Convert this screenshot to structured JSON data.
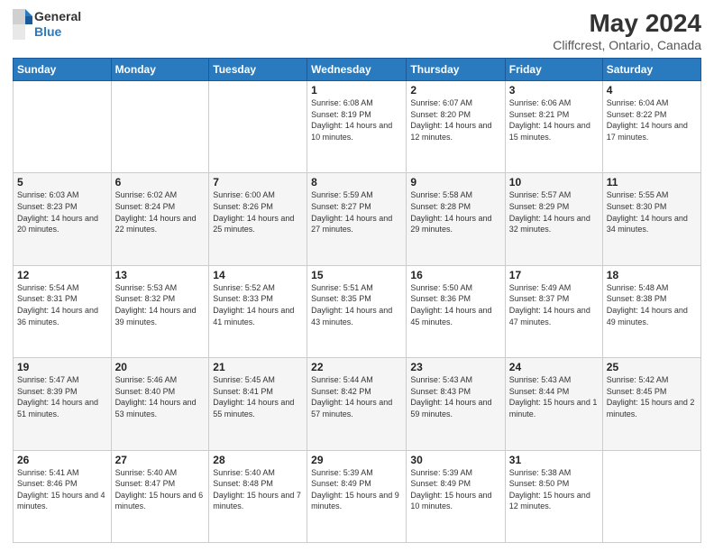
{
  "header": {
    "logo_line1": "General",
    "logo_line2": "Blue",
    "main_title": "May 2024",
    "sub_title": "Cliffcrest, Ontario, Canada"
  },
  "weekdays": [
    "Sunday",
    "Monday",
    "Tuesday",
    "Wednesday",
    "Thursday",
    "Friday",
    "Saturday"
  ],
  "weeks": [
    [
      {
        "day": "",
        "detail": ""
      },
      {
        "day": "",
        "detail": ""
      },
      {
        "day": "",
        "detail": ""
      },
      {
        "day": "1",
        "detail": "Sunrise: 6:08 AM\nSunset: 8:19 PM\nDaylight: 14 hours\nand 10 minutes."
      },
      {
        "day": "2",
        "detail": "Sunrise: 6:07 AM\nSunset: 8:20 PM\nDaylight: 14 hours\nand 12 minutes."
      },
      {
        "day": "3",
        "detail": "Sunrise: 6:06 AM\nSunset: 8:21 PM\nDaylight: 14 hours\nand 15 minutes."
      },
      {
        "day": "4",
        "detail": "Sunrise: 6:04 AM\nSunset: 8:22 PM\nDaylight: 14 hours\nand 17 minutes."
      }
    ],
    [
      {
        "day": "5",
        "detail": "Sunrise: 6:03 AM\nSunset: 8:23 PM\nDaylight: 14 hours\nand 20 minutes."
      },
      {
        "day": "6",
        "detail": "Sunrise: 6:02 AM\nSunset: 8:24 PM\nDaylight: 14 hours\nand 22 minutes."
      },
      {
        "day": "7",
        "detail": "Sunrise: 6:00 AM\nSunset: 8:26 PM\nDaylight: 14 hours\nand 25 minutes."
      },
      {
        "day": "8",
        "detail": "Sunrise: 5:59 AM\nSunset: 8:27 PM\nDaylight: 14 hours\nand 27 minutes."
      },
      {
        "day": "9",
        "detail": "Sunrise: 5:58 AM\nSunset: 8:28 PM\nDaylight: 14 hours\nand 29 minutes."
      },
      {
        "day": "10",
        "detail": "Sunrise: 5:57 AM\nSunset: 8:29 PM\nDaylight: 14 hours\nand 32 minutes."
      },
      {
        "day": "11",
        "detail": "Sunrise: 5:55 AM\nSunset: 8:30 PM\nDaylight: 14 hours\nand 34 minutes."
      }
    ],
    [
      {
        "day": "12",
        "detail": "Sunrise: 5:54 AM\nSunset: 8:31 PM\nDaylight: 14 hours\nand 36 minutes."
      },
      {
        "day": "13",
        "detail": "Sunrise: 5:53 AM\nSunset: 8:32 PM\nDaylight: 14 hours\nand 39 minutes."
      },
      {
        "day": "14",
        "detail": "Sunrise: 5:52 AM\nSunset: 8:33 PM\nDaylight: 14 hours\nand 41 minutes."
      },
      {
        "day": "15",
        "detail": "Sunrise: 5:51 AM\nSunset: 8:35 PM\nDaylight: 14 hours\nand 43 minutes."
      },
      {
        "day": "16",
        "detail": "Sunrise: 5:50 AM\nSunset: 8:36 PM\nDaylight: 14 hours\nand 45 minutes."
      },
      {
        "day": "17",
        "detail": "Sunrise: 5:49 AM\nSunset: 8:37 PM\nDaylight: 14 hours\nand 47 minutes."
      },
      {
        "day": "18",
        "detail": "Sunrise: 5:48 AM\nSunset: 8:38 PM\nDaylight: 14 hours\nand 49 minutes."
      }
    ],
    [
      {
        "day": "19",
        "detail": "Sunrise: 5:47 AM\nSunset: 8:39 PM\nDaylight: 14 hours\nand 51 minutes."
      },
      {
        "day": "20",
        "detail": "Sunrise: 5:46 AM\nSunset: 8:40 PM\nDaylight: 14 hours\nand 53 minutes."
      },
      {
        "day": "21",
        "detail": "Sunrise: 5:45 AM\nSunset: 8:41 PM\nDaylight: 14 hours\nand 55 minutes."
      },
      {
        "day": "22",
        "detail": "Sunrise: 5:44 AM\nSunset: 8:42 PM\nDaylight: 14 hours\nand 57 minutes."
      },
      {
        "day": "23",
        "detail": "Sunrise: 5:43 AM\nSunset: 8:43 PM\nDaylight: 14 hours\nand 59 minutes."
      },
      {
        "day": "24",
        "detail": "Sunrise: 5:43 AM\nSunset: 8:44 PM\nDaylight: 15 hours\nand 1 minute."
      },
      {
        "day": "25",
        "detail": "Sunrise: 5:42 AM\nSunset: 8:45 PM\nDaylight: 15 hours\nand 2 minutes."
      }
    ],
    [
      {
        "day": "26",
        "detail": "Sunrise: 5:41 AM\nSunset: 8:46 PM\nDaylight: 15 hours\nand 4 minutes."
      },
      {
        "day": "27",
        "detail": "Sunrise: 5:40 AM\nSunset: 8:47 PM\nDaylight: 15 hours\nand 6 minutes."
      },
      {
        "day": "28",
        "detail": "Sunrise: 5:40 AM\nSunset: 8:48 PM\nDaylight: 15 hours\nand 7 minutes."
      },
      {
        "day": "29",
        "detail": "Sunrise: 5:39 AM\nSunset: 8:49 PM\nDaylight: 15 hours\nand 9 minutes."
      },
      {
        "day": "30",
        "detail": "Sunrise: 5:39 AM\nSunset: 8:49 PM\nDaylight: 15 hours\nand 10 minutes."
      },
      {
        "day": "31",
        "detail": "Sunrise: 5:38 AM\nSunset: 8:50 PM\nDaylight: 15 hours\nand 12 minutes."
      },
      {
        "day": "",
        "detail": ""
      }
    ]
  ]
}
